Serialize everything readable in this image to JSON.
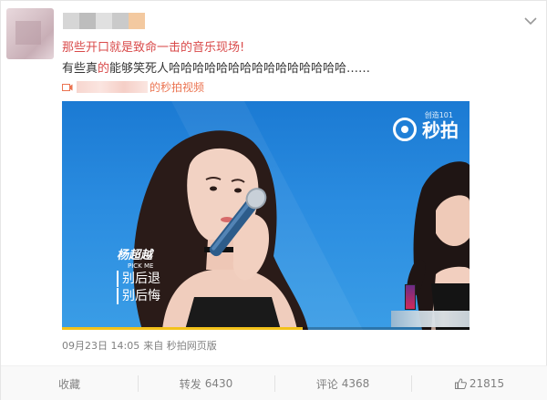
{
  "post": {
    "headline": "那些开口就是致命一击的音乐现场!",
    "body_prefix": "有些真",
    "body_red": "的",
    "body_rest": "能够笑死人哈哈哈哈哈哈哈哈哈哈哈哈哈哈哈……",
    "video_link_suffix": "的秒拍视频",
    "timestamp": "09月23日 14:05",
    "source": "来自 秒拍网页版"
  },
  "video": {
    "watermark_brand": "秒拍",
    "watermark_small": "创造101",
    "name_tag": "杨超越",
    "name_tag_sub": "PICK ME",
    "lyric1": "别后退",
    "lyric2": "别后悔",
    "progress_fraction": 0.59
  },
  "actions": {
    "collect_label": "收藏",
    "repost_label": "转发",
    "repost_count": "6430",
    "comment_label": "评论",
    "comment_count": "4368",
    "like_count": "21815"
  }
}
